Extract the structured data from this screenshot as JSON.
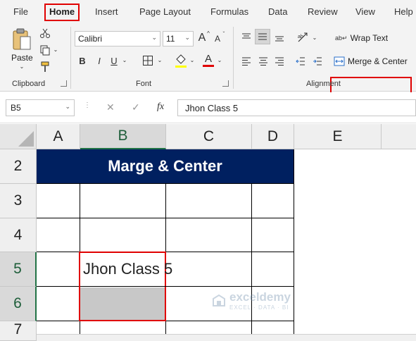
{
  "tabs": {
    "items": [
      "File",
      "Home",
      "Insert",
      "Page Layout",
      "Formulas",
      "Data",
      "Review",
      "View",
      "Help"
    ],
    "active": "Home"
  },
  "clipboard": {
    "paste_label": "Paste",
    "group_label": "Clipboard"
  },
  "font": {
    "name": "Calibri",
    "size": "11",
    "bold": "B",
    "italic": "I",
    "underline": "U",
    "grow": "A",
    "shrink": "A",
    "font_color_letter": "A",
    "group_label": "Font"
  },
  "alignment": {
    "wrap_text": "Wrap Text",
    "merge_center": "Merge & Center",
    "group_label": "Alignment"
  },
  "formula_bar": {
    "name_box": "B5",
    "fx": "fx",
    "value": "Jhon Class 5"
  },
  "columns": [
    "A",
    "B",
    "C",
    "D",
    "E"
  ],
  "selected_column": "B",
  "rows": [
    "2",
    "3",
    "4",
    "5",
    "6",
    "7"
  ],
  "selected_rows": [
    "5",
    "6"
  ],
  "cells": {
    "title": "Marge & Center",
    "b5": "Jhon Class 5"
  },
  "watermark": {
    "name": "exceldemy",
    "sub": "EXCEL · DATA · BI"
  },
  "colors": {
    "header_navy": "#002060",
    "highlight_red": "#e00000",
    "excel_green": "#217346"
  }
}
